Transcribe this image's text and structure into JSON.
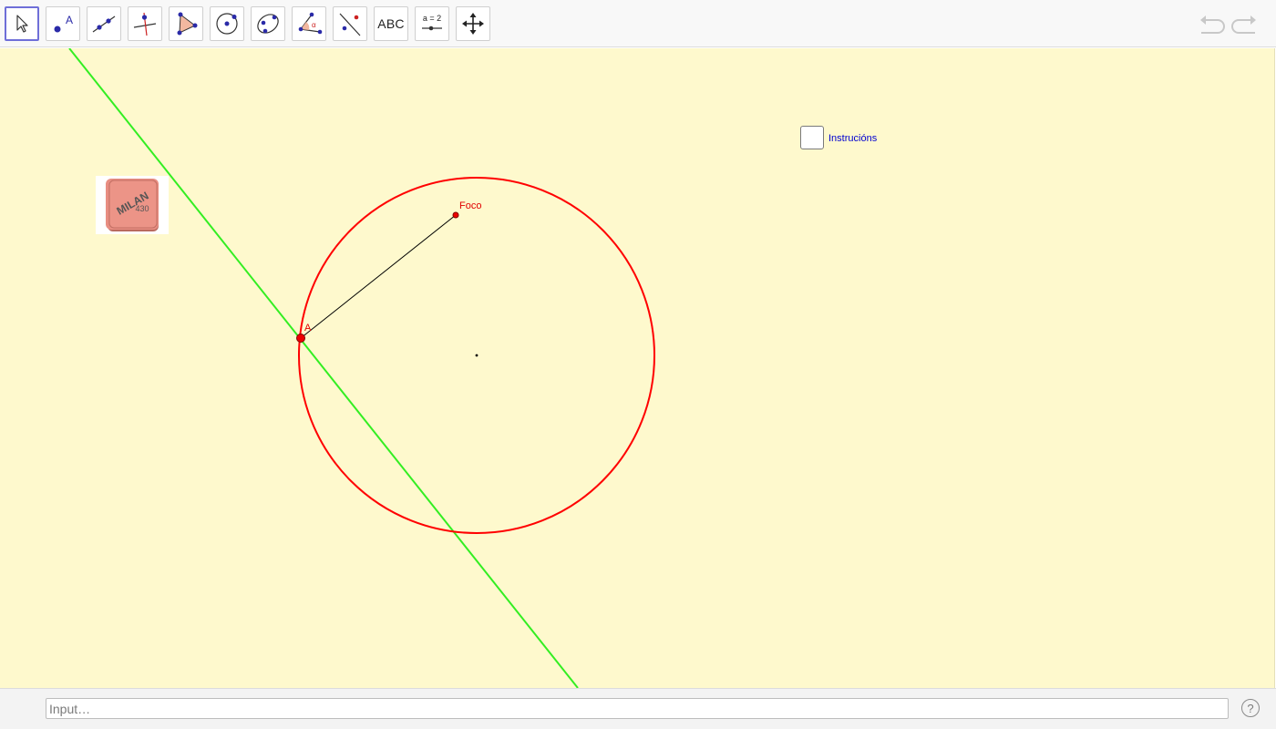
{
  "toolbar": {
    "tools": [
      {
        "name": "move-tool",
        "icon": "cursor-arrow-icon",
        "selected": true
      },
      {
        "name": "point-tool",
        "icon": "point-icon",
        "label": "A"
      },
      {
        "name": "line-tool",
        "icon": "line-through-two-points-icon"
      },
      {
        "name": "perpendicular-line-tool",
        "icon": "perpendicular-line-icon"
      },
      {
        "name": "polygon-tool",
        "icon": "polygon-icon"
      },
      {
        "name": "circle-tool",
        "icon": "circle-center-point-icon"
      },
      {
        "name": "conic-tool",
        "icon": "ellipse-icon"
      },
      {
        "name": "angle-tool",
        "icon": "angle-icon",
        "label": "α"
      },
      {
        "name": "reflect-tool",
        "icon": "reflect-about-line-icon"
      },
      {
        "name": "text-tool",
        "icon": "text-icon",
        "label": "ABC"
      },
      {
        "name": "slider-tool",
        "icon": "slider-icon",
        "label": "a = 2"
      },
      {
        "name": "move-graphics-view-tool",
        "icon": "move-arrows-icon"
      }
    ],
    "undo_icon": "undo-icon",
    "redo_icon": "redo-icon"
  },
  "canvas": {
    "background": "#fef9cd",
    "point_a_label": "A",
    "focus_label": "Foco",
    "checkbox_label": "Instrucións",
    "eraser_brand": "MILAN",
    "eraser_model": "430",
    "colors": {
      "circle": "#ff0000",
      "line": "#33ee22",
      "segment": "#000000",
      "point": "#dd0000",
      "checkbox_label": "#0000d0"
    }
  },
  "input_bar": {
    "placeholder": "Input…",
    "value": "",
    "help_icon": "help-icon",
    "help_text": "?"
  }
}
